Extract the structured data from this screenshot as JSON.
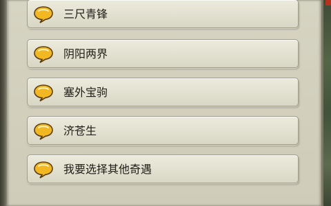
{
  "dialog": {
    "options": [
      {
        "label": "三尺青锋",
        "icon": "speech-bubble-icon"
      },
      {
        "label": "阴阳两界",
        "icon": "speech-bubble-icon"
      },
      {
        "label": "塞外宝驹",
        "icon": "speech-bubble-icon"
      },
      {
        "label": "济苍生",
        "icon": "speech-bubble-icon"
      },
      {
        "label": "我要选择其他奇遇",
        "icon": "speech-bubble-icon"
      }
    ],
    "colors": {
      "panel": "#d3d1be",
      "button": "#e6e4d4",
      "button_border": "#9f9c88",
      "bubble_fill": "#f2b824",
      "bubble_outline": "#5a3c08",
      "text": "#1f1d16",
      "accent_red": "#b7321e"
    }
  }
}
